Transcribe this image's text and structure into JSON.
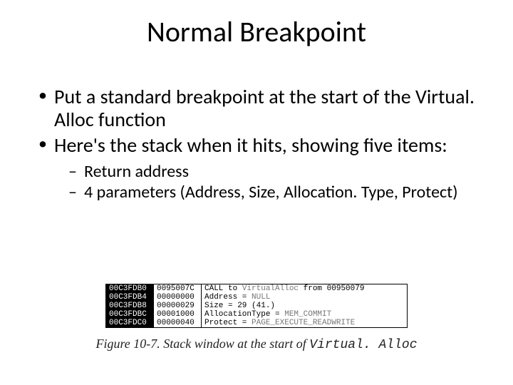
{
  "title": "Normal Breakpoint",
  "bullets": [
    "Put a standard breakpoint at the start of the Virtual. Alloc function",
    "Here's the stack when it hits, showing five items:"
  ],
  "sub_bullets": [
    "Return address",
    "4 parameters (Address, Size, Allocation. Type, Protect)"
  ],
  "stack": [
    {
      "addr": "00C3FDB0",
      "val": "0095007C",
      "desc_prefix": "CALL to ",
      "desc_hl": "VirtualAlloc",
      "desc_suffix": " from 00950079"
    },
    {
      "addr": "00C3FDB4",
      "val": "00000000",
      "desc_prefix": "Address = ",
      "desc_hl": "NULL",
      "desc_suffix": ""
    },
    {
      "addr": "00C3FDB8",
      "val": "00000029",
      "desc_prefix": "Size = 29 (41.)",
      "desc_hl": "",
      "desc_suffix": ""
    },
    {
      "addr": "00C3FDBC",
      "val": "00001000",
      "desc_prefix": "AllocationType = ",
      "desc_hl": "MEM_COMMIT",
      "desc_suffix": ""
    },
    {
      "addr": "00C3FDC0",
      "val": "00000040",
      "desc_prefix": "Protect = ",
      "desc_hl": "PAGE_EXECUTE_READWRITE",
      "desc_suffix": ""
    }
  ],
  "caption_prefix": "Figure 10-7. Stack window at the start of ",
  "caption_code": "Virtual. Alloc"
}
